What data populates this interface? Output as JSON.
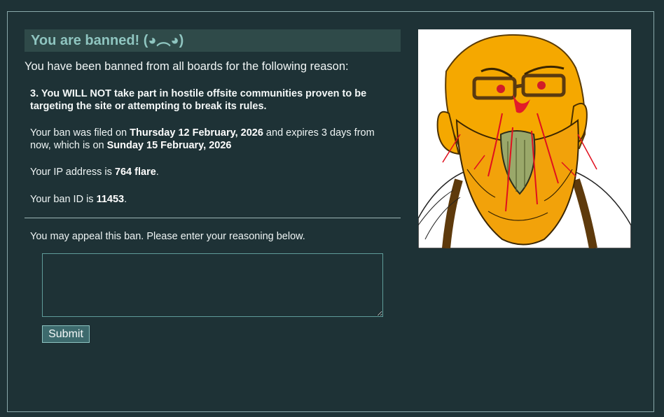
{
  "banner": {
    "title": "You are banned! (◕︵◕)"
  },
  "ban": {
    "intro": "You have been banned from all boards for the following reason:",
    "reason": "3. You WILL NOT take part in hostile offsite communities proven to be targeting the site or attempting to break its rules.",
    "filed_prefix": "Your ban was filed on ",
    "filed_date": "Thursday 12 February, 2026",
    "filed_middle": " and expires 3 days from now, which is on ",
    "expires_date": "Sunday 15 February, 2026",
    "ip_prefix": "Your IP address is ",
    "ip_value": "764 flare",
    "ip_suffix": ".",
    "id_prefix": "Your ban ID is ",
    "id_value": "11453",
    "id_suffix": "."
  },
  "appeal": {
    "prompt": "You may appeal this ban. Please enter your reasoning below.",
    "textarea_value": "",
    "submit_label": "Submit"
  },
  "image": {
    "description_icon": "angry-bearded-man-with-glasses-cartoon"
  },
  "colors": {
    "background": "#1e3236",
    "title_bar": "#2f4a49",
    "title_text": "#8fc5c0",
    "button": "#3d6a6d"
  }
}
